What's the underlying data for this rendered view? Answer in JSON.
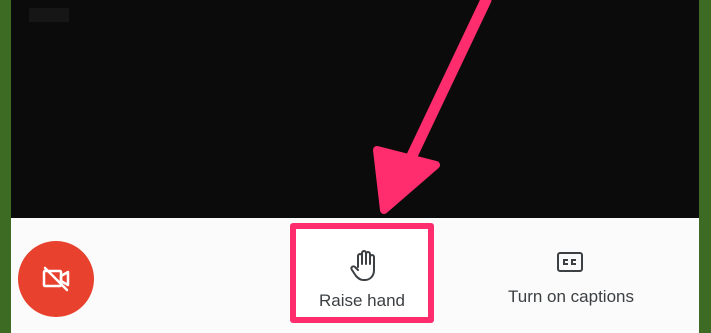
{
  "controls": {
    "raise_hand_label": "Raise hand",
    "captions_label": "Turn on captions"
  },
  "icons": {
    "camera": "camera-off-icon",
    "raise": "hand-icon",
    "captions": "closed-captions-icon"
  },
  "colors": {
    "camera_button": "#e8412e",
    "highlight": "#ff2c6e",
    "video_background": "#0b0b0b",
    "frame_background": "#3d6b24",
    "toolbar_background": "#fbfbfb"
  }
}
